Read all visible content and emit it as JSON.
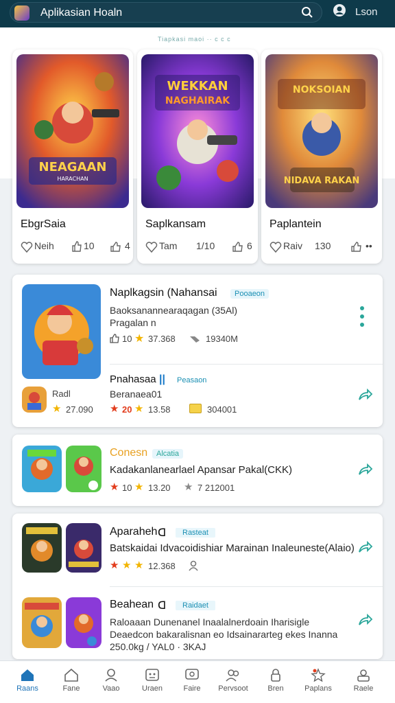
{
  "header": {
    "search_text": "Aplikasian Hoaln",
    "login_label": "Lson"
  },
  "band_caption": "Tiapkasi maoi ·· c c c",
  "featured": [
    {
      "art_title": "NEAGAAN",
      "art_subtitle": "HARACHAN",
      "name": "EbgrSaia",
      "stat1_label": "Neih",
      "stat2": "10",
      "stat3": "4"
    },
    {
      "art_title": "WEKKAN",
      "art_subtitle": "NAGHAIRAK",
      "name": "Saplkansam",
      "stat1_label": "Tam",
      "stat2": "1/10",
      "stat3": "6"
    },
    {
      "art_title": "NOKSOIAN",
      "art_subtitle": "NIDAVA RAKAN",
      "name": "Paplantein",
      "stat1_label": "Raiv",
      "stat2": "130",
      "stat3": "••"
    }
  ],
  "list": [
    {
      "title": "Naplkagsin (Nahansai",
      "badge": "Pooaeon",
      "line1": "Baoksanannearaqagan (35Al)",
      "line2": "Pragalan n",
      "rating": "10",
      "downloads": "37.368",
      "size": "19340M",
      "mini_label": "Radl",
      "mini_rating": "27.090",
      "sub_title": "Pnahasaa",
      "sub_badge": "Peasaon",
      "sub_line": "Beranaea01",
      "sub_rating": "20",
      "sub_downloads": "13.58",
      "sub_size": "304001"
    },
    {
      "title": "Conesn",
      "badge": "Alcatia",
      "line1": "Kadakanlanearlael Apansar Pakal(CKK)",
      "rating": "10",
      "downloads": "13.20",
      "size": "7 212001"
    },
    {
      "title": "Aparaheh",
      "badge": "Rasteat",
      "line1": "Batskaidai Idvacoidishiar Marainan Inaleuneste(Alaio)",
      "downloads": "12.368"
    },
    {
      "title": "Beahean",
      "badge": "Raidaet",
      "line1": "Raloaaan Dunenanel Inaalalnerdoain Iharisigle",
      "line2": "Deaedcon bakaralisnan eo Idsainararteg ekes Inanna",
      "line3": "250.0kg / YAL0 · 3KAJ"
    }
  ],
  "bottom_nav": [
    {
      "label": "Raans",
      "icon": "home-icon"
    },
    {
      "label": "Fane",
      "icon": "house-outline-icon"
    },
    {
      "label": "Vaao",
      "icon": "person-icon"
    },
    {
      "label": "Uraen",
      "icon": "gamepad-icon"
    },
    {
      "label": "Faire",
      "icon": "chat-icon"
    },
    {
      "label": "Pervsoot",
      "icon": "people-icon"
    },
    {
      "label": "Bren",
      "icon": "lock-icon"
    },
    {
      "label": "Paplans",
      "icon": "star-icon"
    },
    {
      "label": "Raele",
      "icon": "profile-icon"
    }
  ],
  "colors": {
    "header_bg": "#0e3a4a",
    "accent": "#2aa69a",
    "nav_active": "#1f74b8",
    "star": "#f2b400",
    "badge": "#1a8fb3"
  }
}
